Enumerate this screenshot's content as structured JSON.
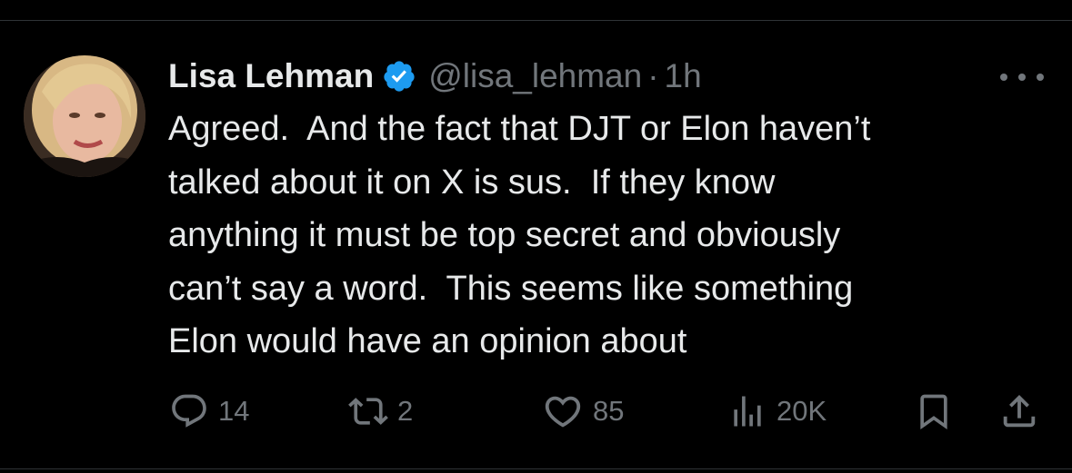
{
  "tweet": {
    "display_name": "Lisa Lehman",
    "handle": "@lisa_lehman",
    "separator": "·",
    "time": "1h",
    "text": "Agreed.  And the fact that DJT or Elon haven’t\ntalked about it on X is sus.  If they know\nanything it must be top secret and obviously\ncan’t say a word.  This seems like something\nElon would have an opinion about",
    "verified": true
  },
  "actions": {
    "replies": "14",
    "reposts": "2",
    "likes": "85",
    "views": "20K"
  },
  "icons": {
    "verified_badge": "verified-badge-icon",
    "more": "more-options-icon",
    "reply": "reply-icon",
    "repost": "repost-icon",
    "like": "heart-icon",
    "views": "views-chart-icon",
    "bookmark": "bookmark-icon",
    "share": "share-icon"
  },
  "colors": {
    "background": "#000000",
    "text_primary": "#e7e9ea",
    "text_secondary": "#71767b",
    "verified_blue": "#1d9bf0",
    "divider": "#2f3336"
  }
}
